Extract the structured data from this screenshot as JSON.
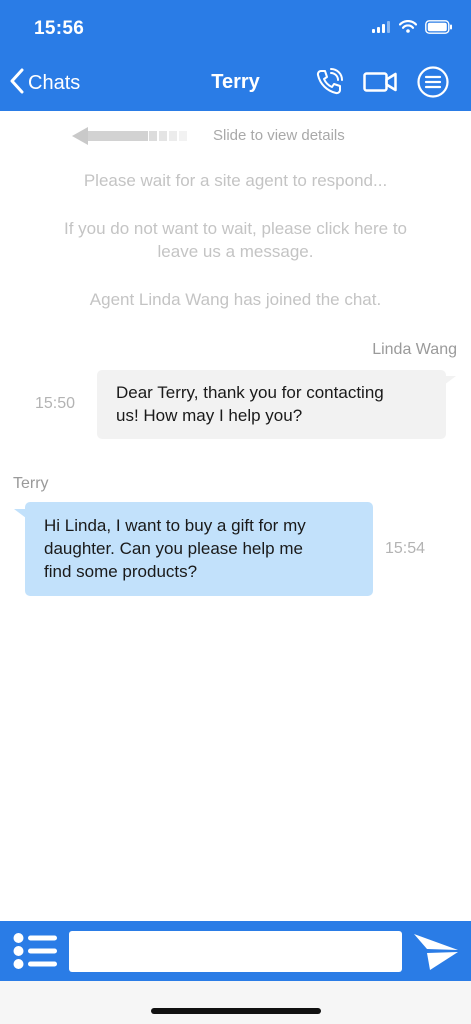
{
  "status_bar": {
    "time": "15:56",
    "icons": [
      "cellular-signal-icon",
      "wifi-icon",
      "battery-icon"
    ]
  },
  "nav": {
    "back_label": "Chats",
    "title": "Terry",
    "actions": [
      "phone-call-icon",
      "video-call-icon",
      "menu-icon"
    ]
  },
  "system": {
    "slide_hint": "Slide to view details",
    "wait_notice": "Please wait for a site agent to respond...",
    "leave_message_line1": "If you do not want to wait, please click here to",
    "leave_message_line2": "leave us a message.",
    "agent_joined": "Agent Linda Wang has joined the chat."
  },
  "messages": [
    {
      "sender": "Linda Wang",
      "time": "15:50",
      "line1": "Dear Terry, thank you for contacting",
      "line2": "us! How may I help you?"
    },
    {
      "sender": "Terry",
      "time": "15:54",
      "line1": "Hi Linda, I want to buy a gift for my",
      "line2": "daughter. Can you please help me",
      "line3": "find some products?"
    }
  ],
  "composer": {
    "value": "",
    "placeholder": ""
  },
  "colors": {
    "brand": "#2a7ce6",
    "agent_bubble": "#f2f2f2",
    "user_bubble": "#c2e1fb"
  }
}
